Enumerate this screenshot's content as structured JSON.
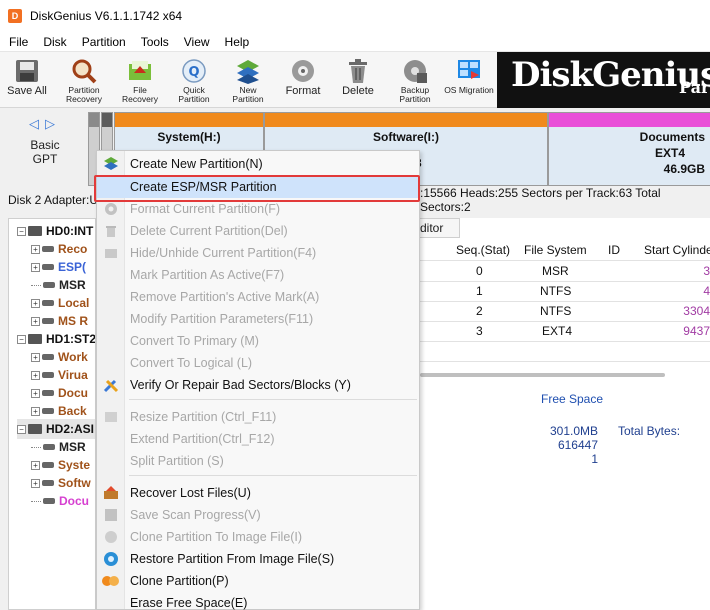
{
  "window": {
    "title": "DiskGenius V6.1.1.1742 x64"
  },
  "menu": [
    "File",
    "Disk",
    "Partition",
    "Tools",
    "View",
    "Help"
  ],
  "toolbar": {
    "save_all": "Save All",
    "partition_recovery": "Partition\nRecovery",
    "file_recovery": "File\nRecovery",
    "quick_partition": "Quick\nPartition",
    "new_partition": "New\nPartition",
    "format": "Format",
    "delete": "Delete",
    "backup_partition": "Backup\nPartition",
    "os_migration": "OS Migration",
    "brand": "DiskGenius",
    "brand_tail": "Part"
  },
  "disk_bar": {
    "basic_label": "Basic",
    "gpt_label": "GPT",
    "partitions": [
      {
        "name": "System(H:)",
        "cap_color": "#f08a1c"
      },
      {
        "name": "Software(I:)",
        "cap_color": "#f08a1c"
      },
      {
        "name": "Documents",
        "fs": "EXT4",
        "size": "46.9GB",
        "cap_color": "#e94fd8"
      }
    ],
    "software_size_tail": "3"
  },
  "info_bar": {
    "left": "Disk 2 Adapter:U",
    "right": ":15566  Heads:255  Sectors per Track:63  Total Sectors:2"
  },
  "tree": [
    {
      "label": "HD0:INT",
      "kind": "disk",
      "color": "#111111"
    },
    {
      "label": "Reco",
      "kind": "part",
      "color": "#a0521a"
    },
    {
      "label": "ESP(",
      "kind": "part",
      "color": "#3a63d6"
    },
    {
      "label": "MSR",
      "kind": "part",
      "color": "#222222"
    },
    {
      "label": "Local",
      "kind": "part",
      "color": "#a0521a"
    },
    {
      "label": "MS R",
      "kind": "part",
      "color": "#a0521a"
    },
    {
      "label": "HD1:ST2",
      "kind": "disk",
      "color": "#111111"
    },
    {
      "label": "Work",
      "kind": "part",
      "color": "#a0521a"
    },
    {
      "label": "Virua",
      "kind": "part",
      "color": "#a0521a"
    },
    {
      "label": "Docu",
      "kind": "part",
      "color": "#a0521a"
    },
    {
      "label": "Back",
      "kind": "part",
      "color": "#a0521a"
    },
    {
      "label": "HD2:ASI",
      "kind": "disk",
      "color": "#111111"
    },
    {
      "label": "MSR",
      "kind": "part",
      "color": "#222222"
    },
    {
      "label": "Syste",
      "kind": "part",
      "color": "#a0521a"
    },
    {
      "label": "Softw",
      "kind": "part",
      "color": "#a0521a"
    },
    {
      "label": "Docu",
      "kind": "part",
      "color": "#d640d0"
    }
  ],
  "right_panel": {
    "tab_label": "ditor",
    "columns": [
      "Seq.(Stat)",
      "File System",
      "ID",
      "Start Cylinde"
    ],
    "rows": [
      {
        "seq": "0",
        "fs": "MSR",
        "start": "3"
      },
      {
        "seq": "1",
        "fs": "NTFS",
        "start": "4"
      },
      {
        "seq": "2",
        "fs": "NTFS",
        "start": "3304"
      },
      {
        "seq": "3",
        "fs": "EXT4",
        "start": "9437"
      }
    ],
    "free_space_label": "Free Space",
    "free_size": "301.0MB",
    "free_sectors": "616447",
    "free_count": "1",
    "total_bytes_label": "Total Bytes:"
  },
  "context_menu": [
    {
      "label": "Create New Partition(N)",
      "enabled": true,
      "icon": "create-partition-icon"
    },
    {
      "label": "Create ESP/MSR Partition",
      "enabled": true,
      "highlighted": true,
      "icon": ""
    },
    {
      "label": "Format Current Partition(F)",
      "enabled": false,
      "icon": "format-icon"
    },
    {
      "label": "Delete Current Partition(Del)",
      "enabled": false,
      "icon": "delete-icon"
    },
    {
      "label": "Hide/Unhide Current Partition(F4)",
      "enabled": false,
      "icon": "hide-icon"
    },
    {
      "label": "Mark Partition As Active(F7)",
      "enabled": false,
      "icon": ""
    },
    {
      "label": "Remove Partition's Active Mark(A)",
      "enabled": false,
      "icon": ""
    },
    {
      "label": "Modify Partition Parameters(F11)",
      "enabled": false,
      "icon": ""
    },
    {
      "label": "Convert To Primary (M)",
      "enabled": false,
      "icon": ""
    },
    {
      "label": "Convert To Logical (L)",
      "enabled": false,
      "icon": ""
    },
    {
      "label": "Verify Or Repair Bad Sectors/Blocks (Y)",
      "enabled": true,
      "icon": "repair-icon"
    },
    {
      "separator": true
    },
    {
      "label": "Resize Partition (Ctrl_F11)",
      "enabled": false,
      "icon": "resize-icon"
    },
    {
      "label": "Extend Partition(Ctrl_F12)",
      "enabled": false,
      "icon": ""
    },
    {
      "label": "Split Partition (S)",
      "enabled": false,
      "icon": ""
    },
    {
      "separator": true
    },
    {
      "label": "Recover Lost Files(U)",
      "enabled": true,
      "icon": "recover-files-icon"
    },
    {
      "label": "Save Scan Progress(V)",
      "enabled": false,
      "icon": "save-icon"
    },
    {
      "label": "Clone Partition To Image File(I)",
      "enabled": false,
      "icon": "image-icon"
    },
    {
      "label": "Restore Partition From Image File(S)",
      "enabled": true,
      "icon": "restore-icon"
    },
    {
      "label": "Clone Partition(P)",
      "enabled": true,
      "icon": "clone-icon"
    },
    {
      "label": "Erase Free Space(E)",
      "enabled": true,
      "icon": ""
    }
  ]
}
